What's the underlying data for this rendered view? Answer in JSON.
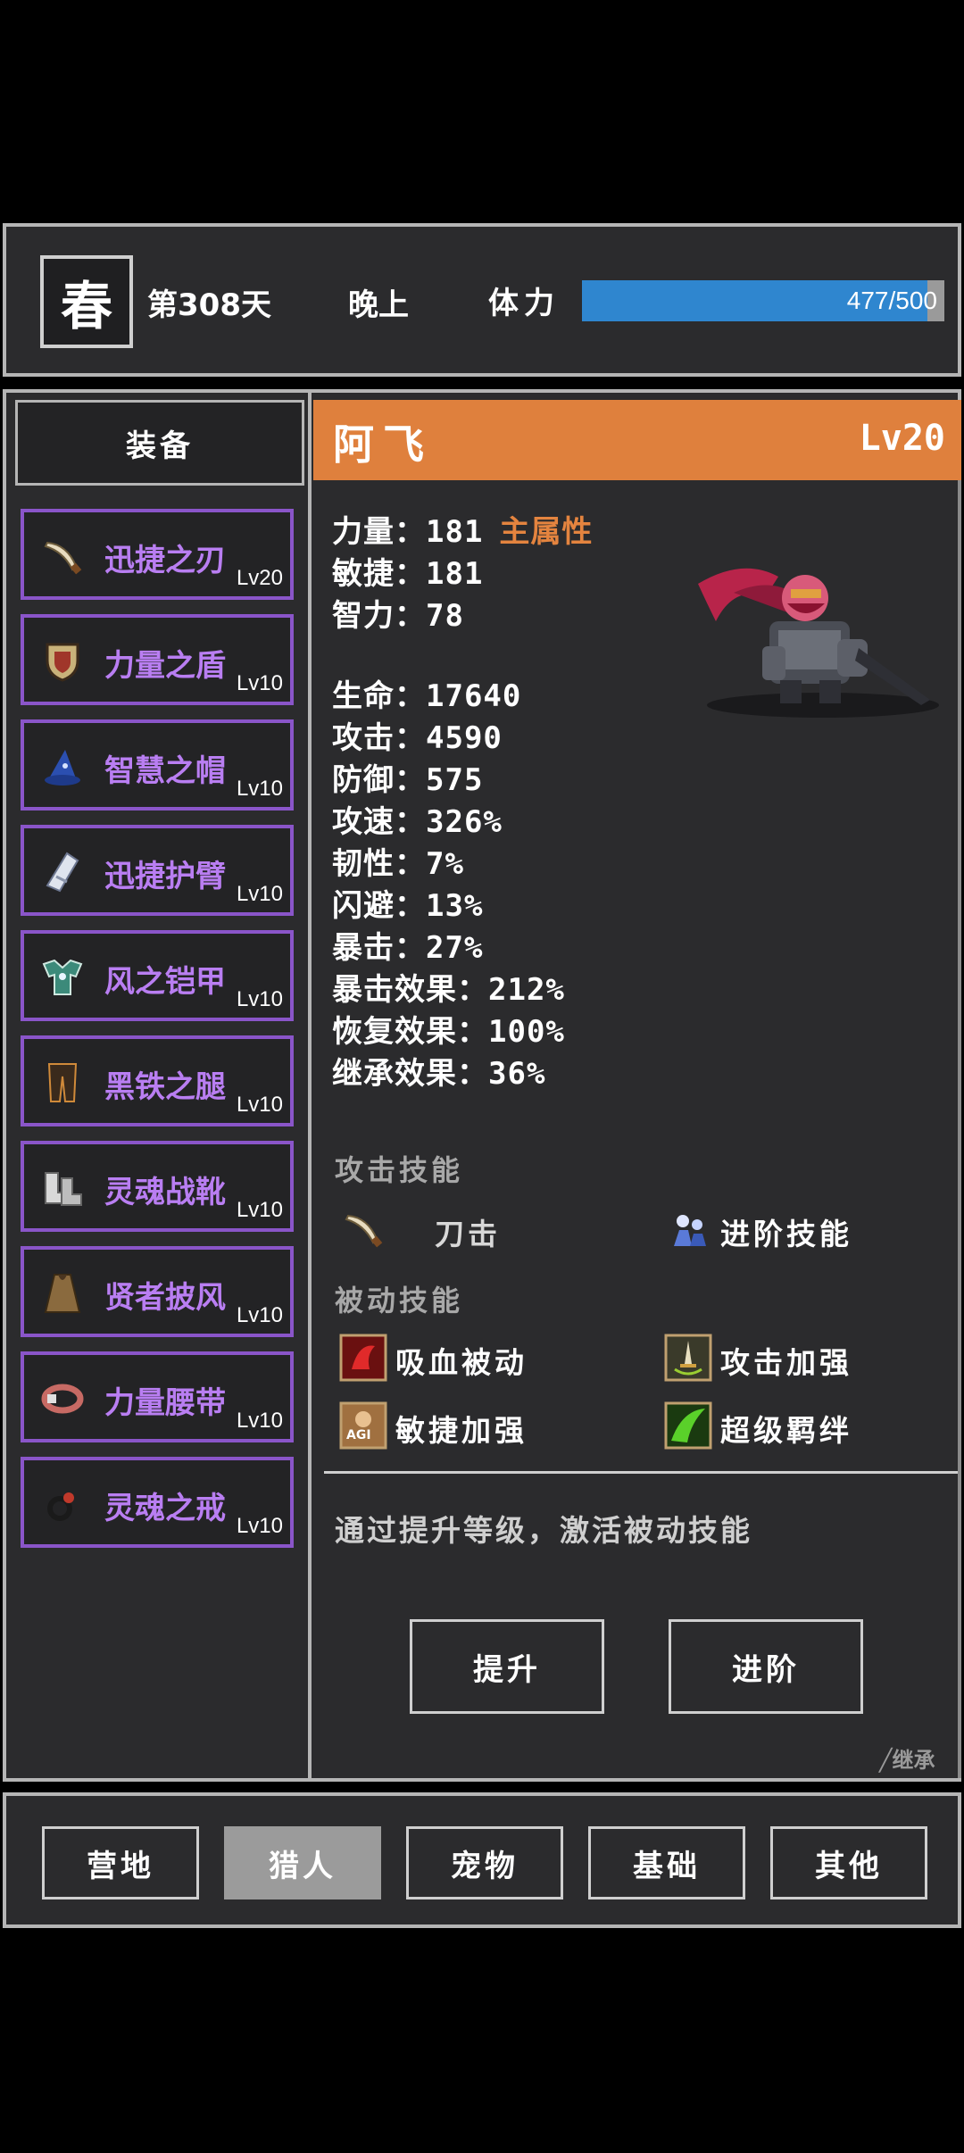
{
  "status": {
    "season": "春",
    "day": "第308天",
    "time_of_day": "晚上",
    "stamina_label": "体力",
    "stamina_text": "477/500",
    "stamina_current": 477,
    "stamina_max": 500,
    "stamina_color": "#2f86cf"
  },
  "equipment": {
    "header": "装备",
    "items": [
      {
        "name": "迅捷之刃",
        "level": "Lv20",
        "selected": true,
        "icon": "blade-icon"
      },
      {
        "name": "力量之盾",
        "level": "Lv10",
        "selected": false,
        "icon": "shield-icon"
      },
      {
        "name": "智慧之帽",
        "level": "Lv10",
        "selected": false,
        "icon": "wizard-hat-icon"
      },
      {
        "name": "迅捷护臂",
        "level": "Lv10",
        "selected": false,
        "icon": "bracer-icon"
      },
      {
        "name": "风之铠甲",
        "level": "Lv10",
        "selected": false,
        "icon": "armor-icon"
      },
      {
        "name": "黑铁之腿",
        "level": "Lv10",
        "selected": false,
        "icon": "leggings-icon"
      },
      {
        "name": "灵魂战靴",
        "level": "Lv10",
        "selected": false,
        "icon": "boots-icon"
      },
      {
        "name": "贤者披风",
        "level": "Lv10",
        "selected": false,
        "icon": "cloak-icon"
      },
      {
        "name": "力量腰带",
        "level": "Lv10",
        "selected": false,
        "icon": "belt-icon"
      },
      {
        "name": "灵魂之戒",
        "level": "Lv10",
        "selected": false,
        "icon": "ring-icon"
      }
    ]
  },
  "hero": {
    "name": "阿飞",
    "level": "Lv20",
    "header_color": "#df803d",
    "primary_tag": "主属性",
    "attributes": [
      {
        "label": "力量：",
        "value": "181"
      },
      {
        "label": "敏捷：",
        "value": "181"
      },
      {
        "label": "智力：",
        "value": "78"
      }
    ],
    "stats": [
      {
        "label": "生命：",
        "value": "17640"
      },
      {
        "label": "攻击：",
        "value": "4590"
      },
      {
        "label": "防御：",
        "value": "575"
      },
      {
        "label": "攻速：",
        "value": "326%"
      },
      {
        "label": "韧性：",
        "value": "7%"
      },
      {
        "label": "闪避：",
        "value": "13%"
      },
      {
        "label": "暴击：",
        "value": "27%"
      },
      {
        "label": "暴击效果：",
        "value": "212%"
      },
      {
        "label": "恢复效果：",
        "value": "100%"
      },
      {
        "label": "继承效果：",
        "value": "36%"
      }
    ]
  },
  "skills": {
    "attack_title": "攻击技能",
    "attack_skill": "刀击",
    "advanced_skill": "进阶技能",
    "passive_title": "被动技能",
    "passives": [
      "吸血被动",
      "攻击加强",
      "敏捷加强",
      "超级羁绊"
    ],
    "agi_badge": "AGI"
  },
  "hint": "通过提升等级，激活被动技能",
  "buttons": {
    "upgrade": "提升",
    "advance": "进阶",
    "inherit": "╱继承"
  },
  "nav": {
    "active": "猎人",
    "tabs": [
      "营地",
      "猎人",
      "宠物",
      "基础",
      "其他"
    ]
  }
}
